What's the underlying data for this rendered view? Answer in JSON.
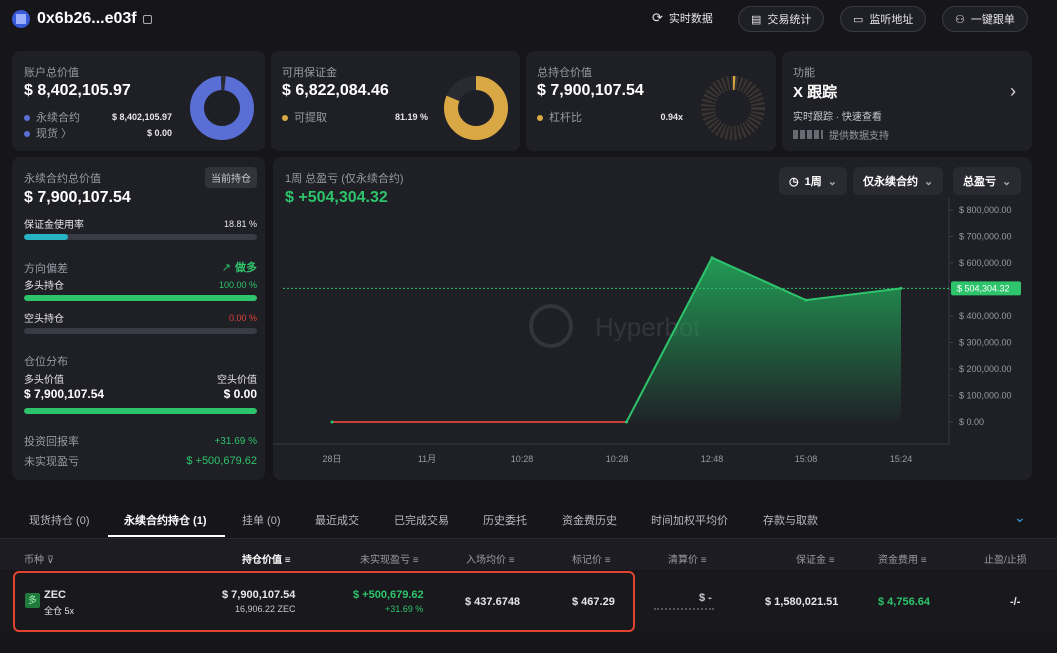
{
  "header": {
    "address": "0x6b26...e03f",
    "buttons": {
      "realtime": "实时数据",
      "stats": "交易统计",
      "monitor": "监听地址",
      "copy": "一键跟单"
    }
  },
  "cards": {
    "total": {
      "label": "账户总价值",
      "value": "$ 8,402,105.97",
      "rows": [
        {
          "name": "永续合约",
          "value": "$ 8,402,105.97",
          "color": "#5a6fd6"
        },
        {
          "name": "现货 〉",
          "value": "$ 0.00",
          "color": "#5a6fd6"
        }
      ]
    },
    "margin": {
      "label": "可用保证金",
      "value": "$ 6,822,084.46",
      "row_name": "可提取",
      "row_value": "81.19 %",
      "row_color": "#d9a845"
    },
    "positions": {
      "label": "总持仓价值",
      "value": "$ 7,900,107.54",
      "row_name": "杠杆比",
      "row_value": "0.94x",
      "row_color": "#d9a845"
    },
    "feature": {
      "label": "功能",
      "title": "X 跟踪",
      "subtitle": "实时跟踪 · 快速查看",
      "source": "提供数据支持"
    }
  },
  "perp": {
    "label": "永续合约总价值",
    "badge": "当前持仓",
    "value": "$ 7,900,107.54",
    "margin_usage_label": "保证金使用率",
    "margin_usage_value": "18.81 %",
    "margin_usage_pct": 18.81,
    "bias_label": "方向偏差",
    "bias_value": "做多",
    "long_label": "多头持仓",
    "long_value": "100.00 %",
    "long_pct": 100,
    "short_label": "空头持仓",
    "short_value": "0.00 %",
    "short_pct": 0,
    "dist_label": "仓位分布",
    "dist_long_label": "多头价值",
    "dist_short_label": "空头价值",
    "dist_long_value": "$ 7,900,107.54",
    "dist_short_value": "$ 0.00",
    "roi_label": "投资回报率",
    "roi_value": "+31.69 %",
    "upnl_label": "未实现盈亏",
    "upnl_value": "$ +500,679.62"
  },
  "pnl_chart": {
    "title": "1周 总盈亏 (仅永续合约)",
    "value": "$ +504,304.32",
    "filters": {
      "period": "1周",
      "scope": "仅永续合约",
      "metric": "总盈亏"
    },
    "watermark": "Hyperbot",
    "current_label": "504,304.32"
  },
  "chart_data": {
    "type": "area",
    "x": [
      "28日",
      "11月",
      "10:28",
      "10:28",
      "12:48",
      "15:08",
      "15:24"
    ],
    "y_ticks": [
      "$ 800,000.00",
      "$ 700,000.00",
      "$ 600,000.00",
      "$ 500,000.00",
      "$ 400,000.00",
      "$ 300,000.00",
      "$ 200,000.00",
      "$ 100,000.00",
      "$ 0.00"
    ],
    "ylim": [
      0,
      800000
    ],
    "points": [
      {
        "x": 0,
        "y": 0
      },
      {
        "x": 3.1,
        "y": 0
      },
      {
        "x": 4.0,
        "y": 620000
      },
      {
        "x": 5.0,
        "y": 460000
      },
      {
        "x": 6.0,
        "y": 504304.32
      }
    ],
    "reference_line": 504304.32,
    "colors": {
      "positive": "#2ec46b",
      "flat": "#c9423a"
    }
  },
  "tabs": [
    "现货持仓 (0)",
    "永续合约持仓 (1)",
    "挂单 (0)",
    "最近成交",
    "已完成交易",
    "历史委托",
    "资金费历史",
    "时间加权平均价",
    "存款与取款"
  ],
  "table": {
    "headers": [
      "币种",
      "持仓价值",
      "未实现盈亏",
      "入场均价",
      "标记价",
      "清算价",
      "保证金",
      "资金费用",
      "止盈/止损"
    ],
    "row": {
      "badge": "多",
      "coin": "ZEC",
      "mode": "全仓 5x",
      "value": "$ 7,900,107.54",
      "size": "16,906.22 ZEC",
      "upnl": "$ +500,679.62",
      "upnl_pct": "+31.69 %",
      "entry": "$ 437.6748",
      "mark": "$ 467.29",
      "liq": "$ -",
      "margin": "$ 1,580,021.51",
      "funding": "$ 4,756.64",
      "tpsl": "-/-"
    }
  }
}
